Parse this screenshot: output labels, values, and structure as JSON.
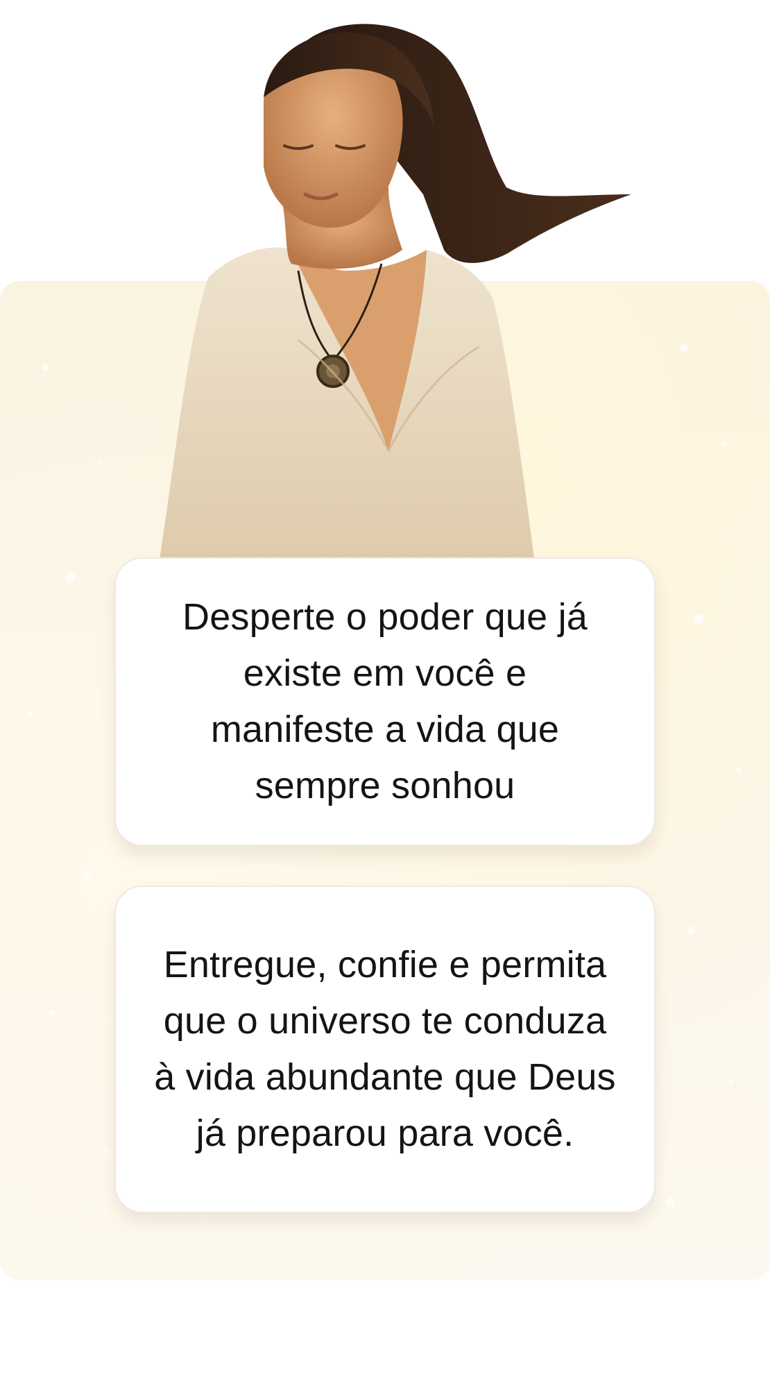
{
  "colors": {
    "panel_background": "#fbf3e1",
    "card_background": "#ffffff",
    "text": "#141414"
  },
  "hero": {
    "image": "meditating-woman-portrait"
  },
  "cards": [
    {
      "text": "Desperte o poder que já existe em você e manifeste a vida que sempre sonhou"
    },
    {
      "text": "Entregue, confie e permita que o universo te conduza à vida abundante que Deus já preparou para você."
    }
  ]
}
